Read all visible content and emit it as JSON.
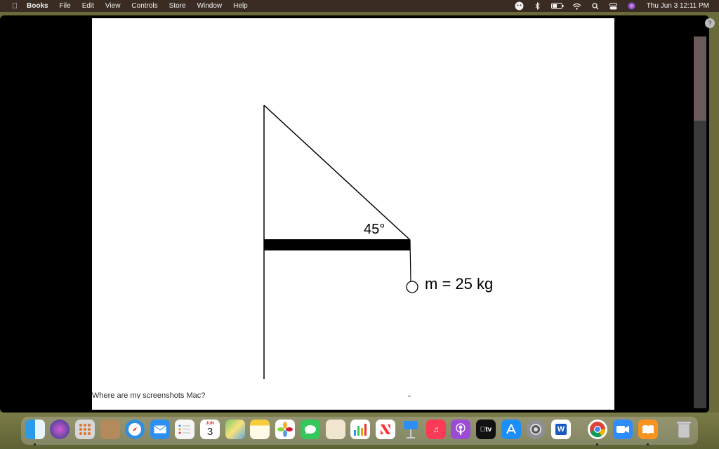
{
  "menubar": {
    "app_name": "Books",
    "menus": [
      "File",
      "Edit",
      "View",
      "Controls",
      "Store",
      "Window",
      "Help"
    ],
    "clock": "Thu Jun 3  12:11 PM"
  },
  "diagram": {
    "angle_label": "45°",
    "mass_label": "m = 25 kg"
  },
  "caption": "Where are my screenshots Mac?",
  "dock": {
    "calendar_month": "JUN",
    "calendar_day": "3",
    "appletv_label": "tv",
    "word_label": "W"
  },
  "colors": {
    "menubar_bg": "#3a2c22",
    "page_bg": "#ffffff"
  }
}
